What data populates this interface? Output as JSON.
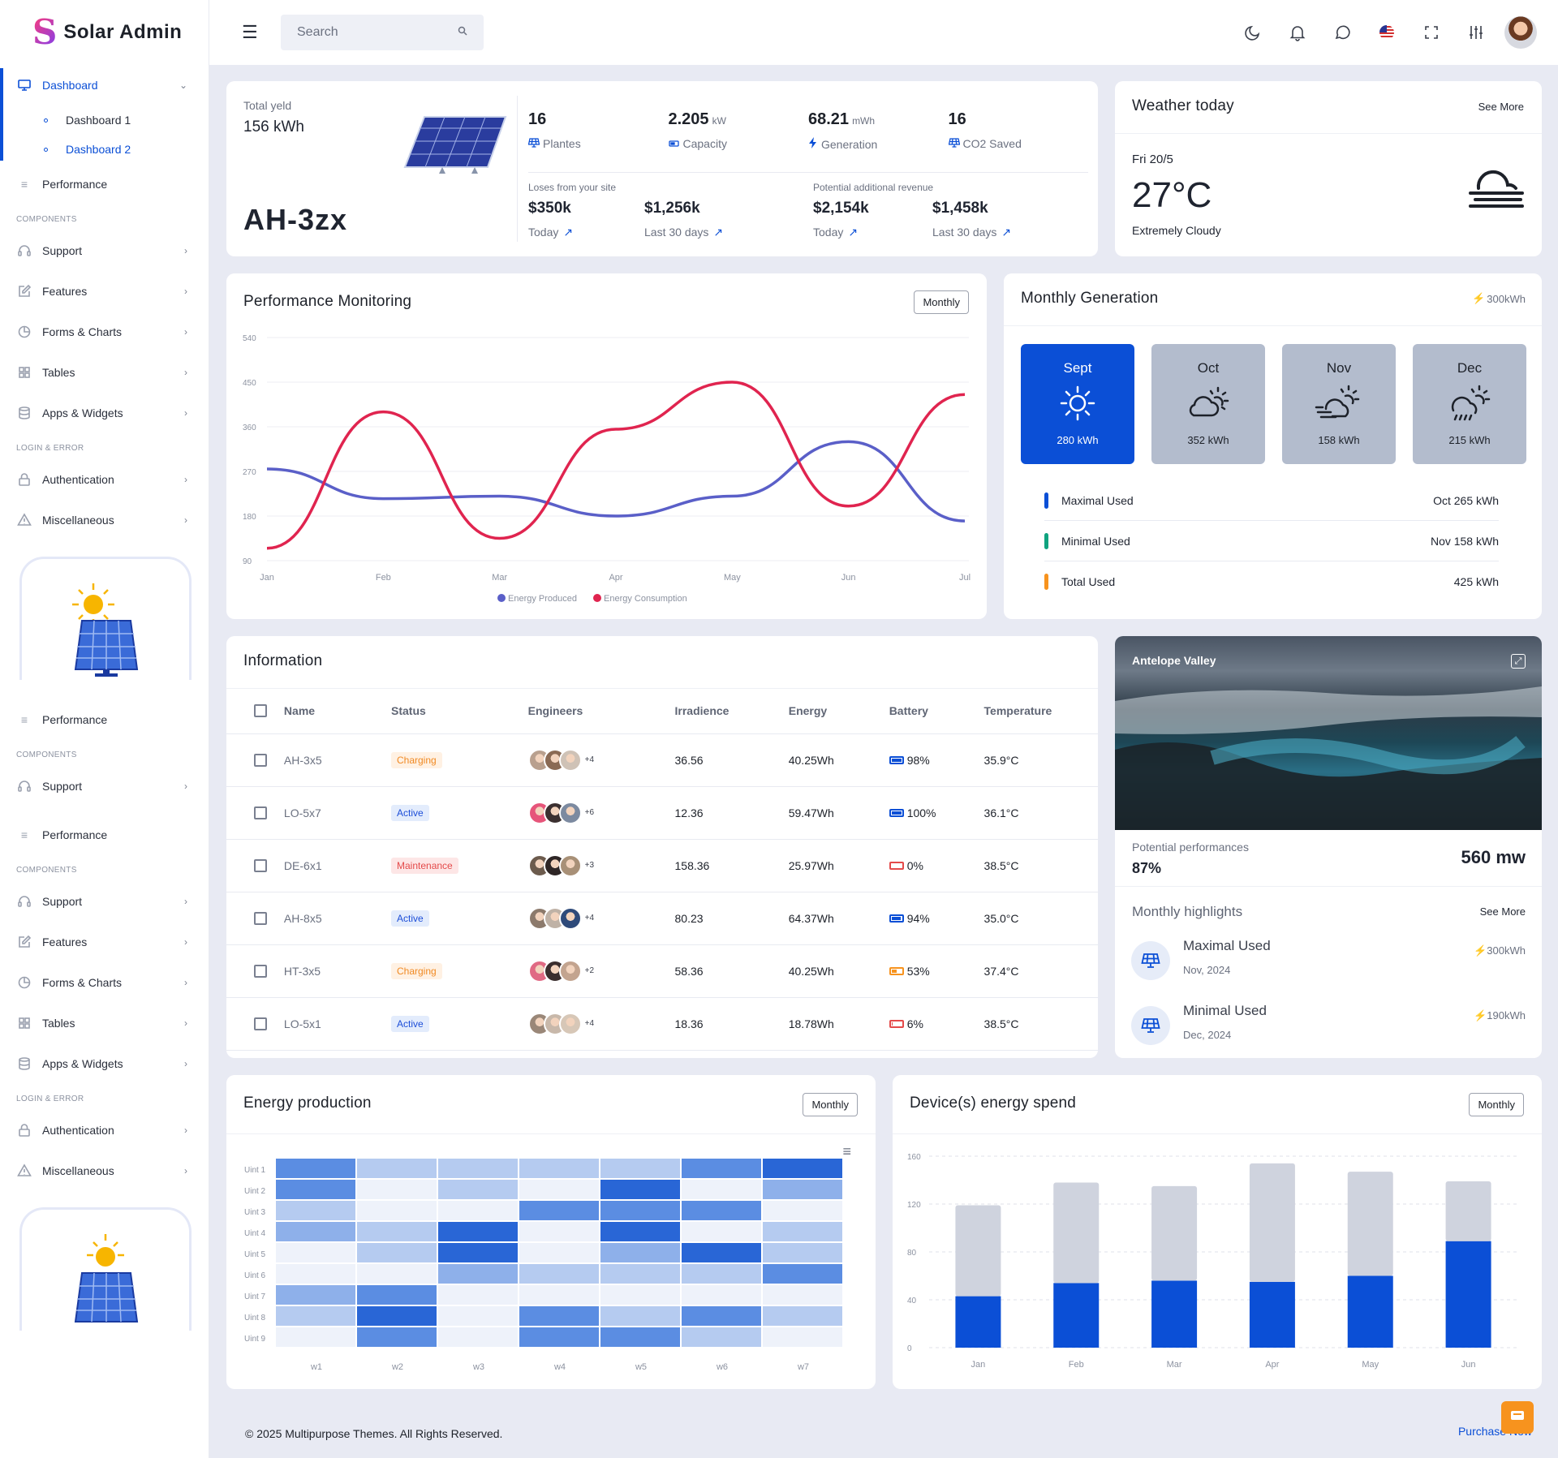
{
  "brand": {
    "mark": "S",
    "name": "Solar Admin"
  },
  "search": {
    "placeholder": "Search"
  },
  "sidebar": {
    "dashboard": "Dashboard",
    "dashboard1": "Dashboard 1",
    "dashboard2": "Dashboard 2",
    "performance": "Performance",
    "components": "COMPONENTS",
    "support": "Support",
    "features": "Features",
    "forms_charts": "Forms & Charts",
    "tables": "Tables",
    "apps_widgets": "Apps & Widgets",
    "login_error": "LOGIN & ERROR",
    "authentication": "Authentication",
    "miscellaneous": "Miscellaneous"
  },
  "site": {
    "total_label": "Total yeld",
    "total_value": "156 kWh",
    "site_name": "AH-3zx",
    "stats": [
      {
        "num": "16",
        "unit": "",
        "label": "Plantes",
        "icon": "solar-panel-icon"
      },
      {
        "num": "2.205",
        "unit": "kW",
        "label": "Capacity",
        "icon": "battery-icon"
      },
      {
        "num": "68.21",
        "unit": "mWh",
        "label": "Generation",
        "icon": "bolt-icon"
      },
      {
        "num": "16",
        "unit": "",
        "label": "CO2 Saved",
        "icon": "solar-panel-icon"
      }
    ],
    "losses_label": "Loses from your site",
    "revenue_label": "Potential additional revenue",
    "money": [
      {
        "value": "$350k",
        "period": "Today"
      },
      {
        "value": "$1,256k",
        "period": "Last 30 days"
      },
      {
        "value": "$2,154k",
        "period": "Today"
      },
      {
        "value": "$1,458k",
        "period": "Last 30 days"
      }
    ]
  },
  "weather": {
    "title": "Weather today",
    "see_more": "See More",
    "date": "Fri 20/5",
    "temp": "27°C",
    "desc": "Extremely Cloudy"
  },
  "perf": {
    "title": "Performance Monitoring",
    "button": "Monthly"
  },
  "monthly": {
    "title": "Monthly Generation",
    "badge": "300kWh",
    "tiles": [
      {
        "month": "Sept",
        "kwh": "280 kWh",
        "icon": "sun-icon"
      },
      {
        "month": "Oct",
        "kwh": "352 kWh",
        "icon": "partly-cloudy-icon"
      },
      {
        "month": "Nov",
        "kwh": "158 kWh",
        "icon": "windy-cloud-icon"
      },
      {
        "month": "Dec",
        "kwh": "215 kWh",
        "icon": "rain-cloud-icon"
      }
    ],
    "usage": [
      {
        "label": "Maximal Used",
        "value": "Oct 265 kWh",
        "color": "#0b4fd6"
      },
      {
        "label": "Minimal Used",
        "value": "Nov 158 kWh",
        "color": "#10a37f"
      },
      {
        "label": "Total Used",
        "value": "425 kWh",
        "color": "#f7931e"
      }
    ]
  },
  "info": {
    "title": "Information",
    "headers": [
      "Name",
      "Status",
      "Engineers",
      "Irradience",
      "Energy",
      "Battery",
      "Temperature"
    ],
    "rows": [
      {
        "name": "AH-3x5",
        "status": "Charging",
        "more": "+4",
        "irr": "36.56",
        "energy": "40.25Wh",
        "battery": "98%",
        "bpct": 0.98,
        "temp": "35.9°C"
      },
      {
        "name": "LO-5x7",
        "status": "Active",
        "more": "+6",
        "irr": "12.36",
        "energy": "59.47Wh",
        "battery": "100%",
        "bpct": 1.0,
        "temp": "36.1°C"
      },
      {
        "name": "DE-6x1",
        "status": "Maintenance",
        "more": "+3",
        "irr": "158.36",
        "energy": "25.97Wh",
        "battery": "0%",
        "bpct": 0,
        "temp": "38.5°C"
      },
      {
        "name": "AH-8x5",
        "status": "Active",
        "more": "+4",
        "irr": "80.23",
        "energy": "64.37Wh",
        "battery": "94%",
        "bpct": 0.94,
        "temp": "35.0°C"
      },
      {
        "name": "HT-3x5",
        "status": "Charging",
        "more": "+2",
        "irr": "58.36",
        "energy": "40.25Wh",
        "battery": "53%",
        "bpct": 0.53,
        "temp": "37.4°C"
      },
      {
        "name": "LO-5x1",
        "status": "Active",
        "more": "+4",
        "irr": "18.36",
        "energy": "18.78Wh",
        "battery": "6%",
        "bpct": 0.06,
        "temp": "38.5°C"
      }
    ]
  },
  "valley": {
    "title": "Antelope Valley",
    "potential_label": "Potential performances",
    "potential_pct": "87%",
    "potential_mw": "560 mw",
    "highlights_title": "Monthly highlights",
    "see_more": "See More",
    "items": [
      {
        "label": "Maximal Used",
        "date": "Nov, 2024",
        "value": "300kWh"
      },
      {
        "label": "Minimal Used",
        "date": "Dec, 2024",
        "value": "190kWh"
      }
    ]
  },
  "energy_prod": {
    "title": "Energy production",
    "button": "Monthly"
  },
  "device": {
    "title": "Device(s) energy spend",
    "button": "Monthly"
  },
  "footer": {
    "text": "© 2025 Multipurpose Themes. All Rights Reserved.",
    "purchase": "Purchase Now"
  },
  "chart_data": [
    {
      "type": "line",
      "x": [
        "Jan",
        "Feb",
        "Mar",
        "Apr",
        "May",
        "Jun",
        "Jul"
      ],
      "ylim": [
        90,
        540
      ],
      "yticks": [
        90,
        180,
        270,
        360,
        450,
        540
      ],
      "grid": true,
      "legend": "bottom",
      "series": [
        {
          "name": "Energy Produced",
          "color": "#5a5fc8",
          "values": [
            275,
            215,
            220,
            180,
            220,
            330,
            170
          ]
        },
        {
          "name": "Energy Consumption",
          "color": "#e0244f",
          "values": [
            115,
            390,
            135,
            355,
            450,
            200,
            425
          ]
        }
      ]
    },
    {
      "type": "heatmap",
      "x": [
        "w1",
        "w2",
        "w3",
        "w4",
        "w5",
        "w6",
        "w7"
      ],
      "y": [
        "Uint 1",
        "Uint 2",
        "Uint 3",
        "Uint 4",
        "Uint 5",
        "Uint 6",
        "Uint 7",
        "Uint 8",
        "Uint 9"
      ],
      "values": [
        [
          3,
          1,
          1,
          1,
          1,
          3,
          4
        ],
        [
          3,
          0,
          1,
          0,
          4,
          0,
          2
        ],
        [
          1,
          0,
          0,
          3,
          3,
          3,
          0
        ],
        [
          2,
          1,
          4,
          0,
          4,
          0,
          1
        ],
        [
          0,
          1,
          4,
          0,
          2,
          4,
          1
        ],
        [
          0,
          0,
          2,
          1,
          1,
          1,
          3
        ],
        [
          2,
          3,
          0,
          0,
          0,
          0,
          0
        ],
        [
          1,
          4,
          0,
          3,
          1,
          3,
          1
        ],
        [
          0,
          3,
          0,
          3,
          3,
          1,
          0
        ]
      ]
    },
    {
      "type": "bar",
      "stacked": true,
      "categories": [
        "Jan",
        "Feb",
        "Mar",
        "Apr",
        "May",
        "Jun"
      ],
      "ylim": [
        0,
        160
      ],
      "yticks": [
        0,
        40,
        80,
        120,
        160
      ],
      "series": [
        {
          "color": "#0b4fd6",
          "values": [
            43,
            54,
            56,
            55,
            60,
            89
          ]
        },
        {
          "color": "#cfd3de",
          "values": [
            76,
            84,
            79,
            99,
            87,
            50
          ]
        }
      ]
    }
  ]
}
